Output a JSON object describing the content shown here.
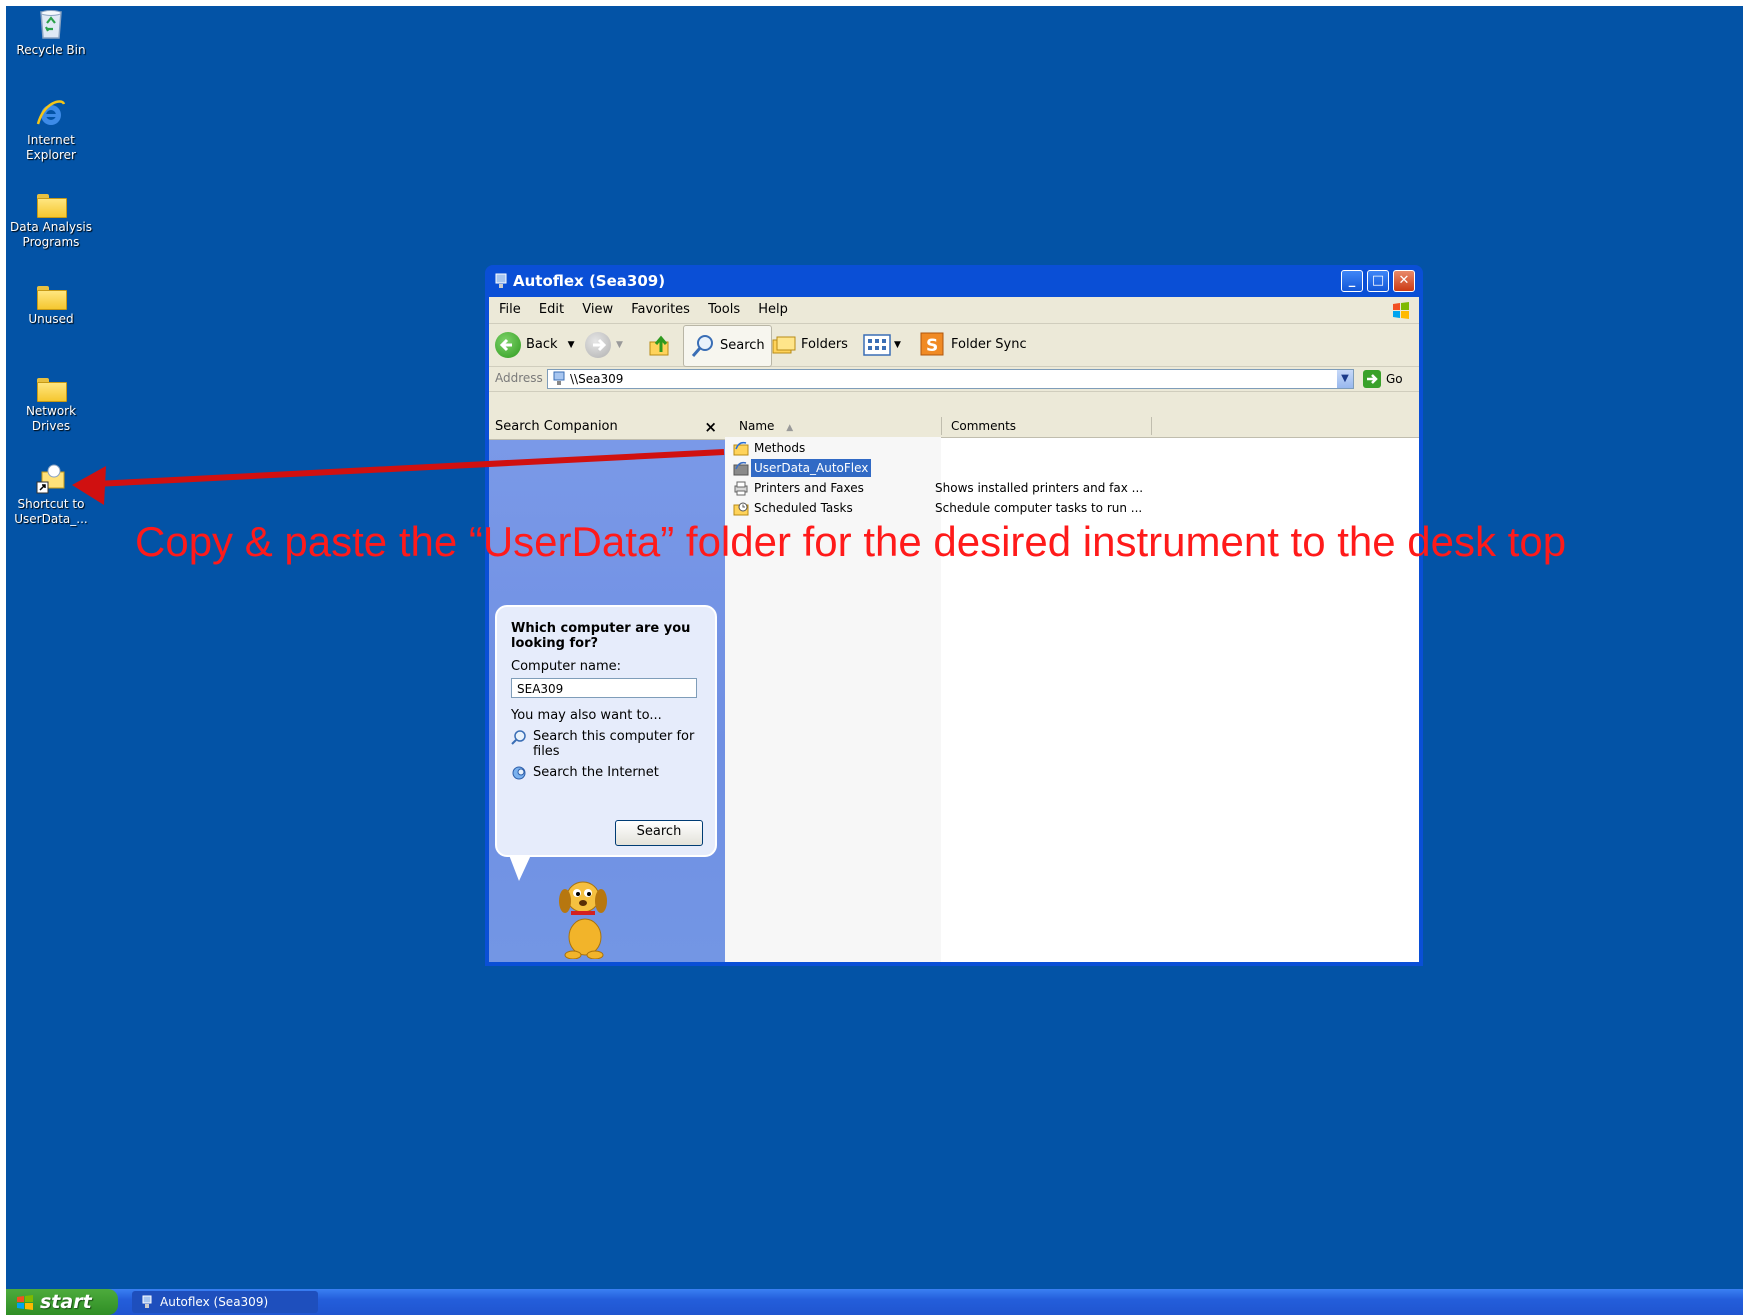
{
  "desktop": {
    "icons": [
      {
        "label": "Recycle Bin"
      },
      {
        "label": "Internet\nExplorer"
      },
      {
        "label": "Data Analysis\nPrograms"
      },
      {
        "label": "Unused"
      },
      {
        "label": "Network\nDrives"
      },
      {
        "label": "Shortcut to\nUserData_..."
      }
    ]
  },
  "window": {
    "title": "Autoflex (Sea309)",
    "menu": [
      "File",
      "Edit",
      "View",
      "Favorites",
      "Tools",
      "Help"
    ],
    "toolbar": {
      "back": "Back",
      "search": "Search",
      "folders": "Folders",
      "folder_sync": "Folder Sync"
    },
    "address": {
      "label": "Address",
      "value": "\\\\Sea309",
      "go": "Go"
    },
    "search_companion": {
      "title": "Search Companion",
      "close": "×",
      "question": "Which computer are you looking for?",
      "computer_name_label": "Computer name:",
      "computer_name_value": "SEA309",
      "also": "You may also want to...",
      "link1": "Search this computer for files",
      "link2": "Search the Internet",
      "search_button": "Search"
    },
    "list": {
      "col_name": "Name",
      "col_comments": "Comments",
      "items": [
        {
          "name": "Methods",
          "comment": ""
        },
        {
          "name": "UserData_AutoFlex",
          "comment": ""
        },
        {
          "name": "Printers and Faxes",
          "comment": "Shows installed printers and fax ..."
        },
        {
          "name": "Scheduled Tasks",
          "comment": "Schedule computer tasks to run ..."
        }
      ]
    }
  },
  "taskbar": {
    "start": "start",
    "task": "Autoflex (Sea309)"
  },
  "annotation": {
    "text": "Copy & paste the “UserData” folder for the desired instrument to the desk top",
    "color": "#ff1a1a"
  }
}
